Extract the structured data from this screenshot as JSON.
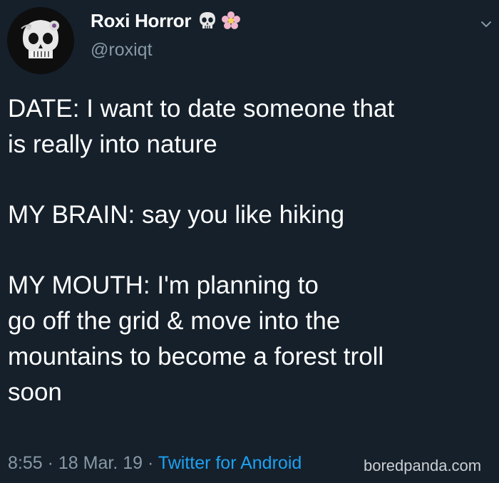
{
  "tweet": {
    "author": {
      "display_name": "Roxi Horror",
      "handle": "@roxiqt",
      "name_emojis": [
        "skull-icon",
        "flower-icon"
      ]
    },
    "paragraphs": [
      "DATE: I want to date someone that\nis really into nature",
      "MY BRAIN: say you like hiking",
      "MY MOUTH: I'm planning to\ngo off the grid & move into the\nmountains to become a forest troll\nsoon"
    ],
    "time": "8:55",
    "date": "18 Mar. 19",
    "separator": " · ",
    "source": "Twitter for Android",
    "menu_icon": "chevron-down-icon"
  },
  "watermark": "boredpanda.com",
  "colors": {
    "background": "#15202b",
    "text": "#ffffff",
    "secondary": "#8899a6",
    "link": "#1da1f2"
  }
}
